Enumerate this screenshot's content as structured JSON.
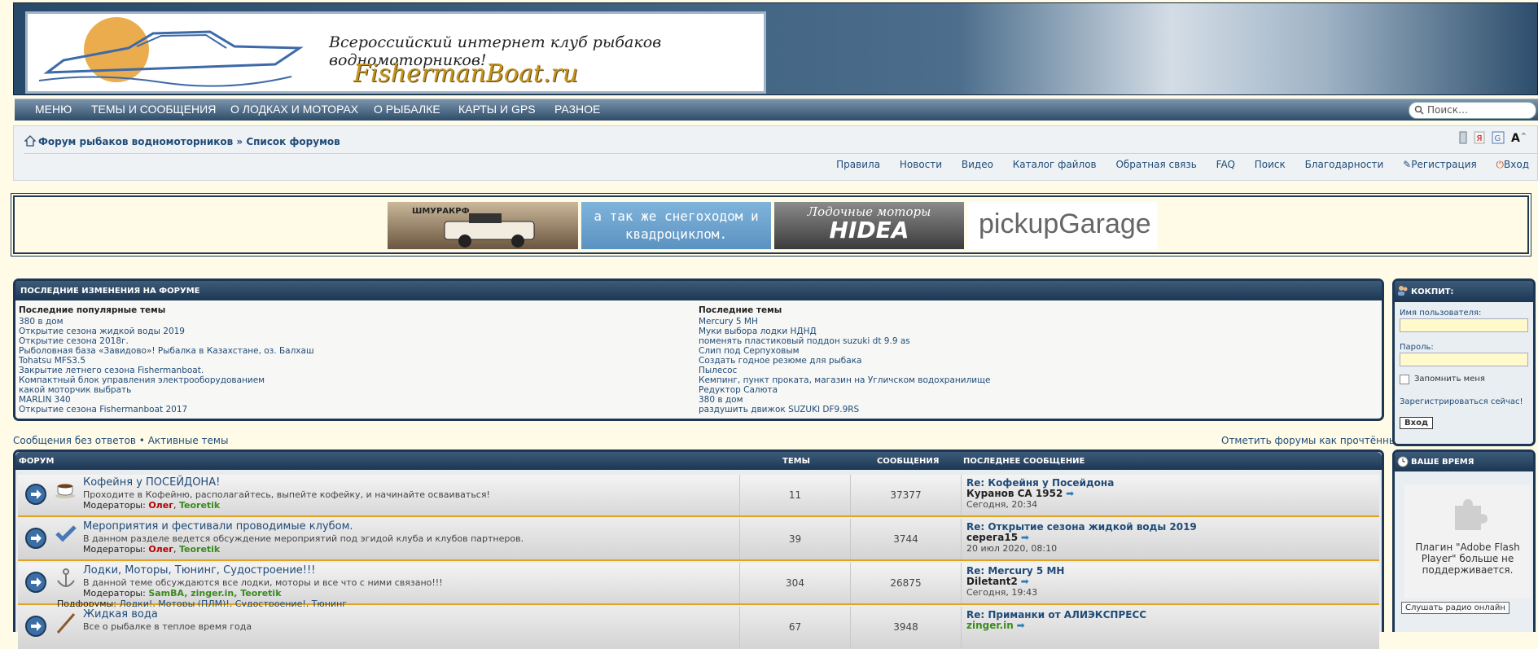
{
  "header": {
    "slogan": "Всероссийский интернет клуб рыбаков водномоторников!",
    "brand": "FishermanBoat.ru"
  },
  "nav": {
    "items": [
      "МЕНЮ",
      "ТЕМЫ И СООБЩЕНИЯ",
      "О ЛОДКАХ И МОТОРАХ",
      "О РЫБАЛКЕ",
      "КАРТЫ И GPS",
      "РАЗНОЕ"
    ],
    "search_placeholder": "Поиск…"
  },
  "breadcrumb": {
    "text": "Форум рыбаков водномоторников » Список форумов"
  },
  "toplinks": [
    "Правила",
    "Новости",
    "Видео",
    "Каталог файлов",
    "Обратная связь",
    "FAQ",
    "Поиск",
    "Благодарности",
    "Регистрация",
    "Вход"
  ],
  "banners": {
    "b1": "ШМУРАКРФ",
    "b2": "а так же снегоходом и квадроциклом.",
    "b3_title": "Лодочные моторы",
    "b3_brand": "HIDEA",
    "b4": "pickupGarage"
  },
  "recent": {
    "title": "ПОСЛЕДНИЕ ИЗМЕНЕНИЯ НА ФОРУМЕ",
    "popular_heading": "Последние популярные темы",
    "popular": [
      "380 в дом",
      "Открытие сезона жидкой воды 2019",
      "Открытие сезона 2018г.",
      "Рыболовная база «Завидово»! Рыбалка в Казахстане, оз. Балхаш",
      "Tohatsu MFS3.5",
      "Закрытие летнего сезона Fishermanboat.",
      "Компактный блок управления электрооборудованием",
      "какой моторчик выбрать",
      "MARLIN 340",
      "Открытие сезона Fishermanboat 2017"
    ],
    "last_heading": "Последние темы",
    "last": [
      "Mercury 5 MH",
      "Муки выбора лодки НДНД",
      "поменять пластиковый поддон suzuki dt 9.9 as",
      "Слип под Серпуховым",
      "Создать годное резюме для рыбака",
      "Пылесос",
      "Кемпинг, пункт проката, магазин на Угличском водохранилище",
      "Редуктор Салюта",
      "380 в дом",
      "раздушить движок SUZUKI DF9.9RS"
    ]
  },
  "links_left": "Сообщения без ответов • Активные темы",
  "links_right": "Отметить форумы как прочтённые",
  "forum": {
    "headers": {
      "forum": "ФОРУМ",
      "topics": "ТЕМЫ",
      "posts": "СООБЩЕНИЯ",
      "last": "ПОСЛЕДНЕЕ СООБЩЕНИЕ"
    },
    "rows": [
      {
        "title": "Кофейня у ПОСЕЙДОНА!",
        "desc": "Проходите в Кофейню, располагайтесь, выпейте кофейку, и начинайте осваиваться!",
        "mods_label": "Модераторы:",
        "mod1": "Олег",
        "mod2": "Teoretik",
        "topics": "11",
        "posts": "37377",
        "last_title": "Re: Кофейня у Посейдона",
        "last_user": "Куранов СА 1952",
        "last_date": "Сегодня, 20:34"
      },
      {
        "title": "Мероприятия и фестивали проводимые клубом.",
        "desc": "В данном разделе ведется обсуждение мероприятий под эгидой клуба и клубов партнеров.",
        "mods_label": "Модераторы:",
        "mod1": "Олег",
        "mod2": "Teoretik",
        "topics": "39",
        "posts": "3744",
        "last_title": "Re: Открытие сезона жидкой воды 2019",
        "last_user": "серега15",
        "last_date": "20 июл 2020, 08:10"
      },
      {
        "title": "Лодки, Моторы, Тюнинг, Судостроение!!!",
        "desc": "В данной теме обсуждаются все лодки, моторы и все что с ними связано!!!",
        "mods_label": "Модераторы:",
        "mods_list": "SamBA, zinger.in, Teoretik",
        "subs_label": "Подфорумы:",
        "subs": "Лодки!, Моторы (ПЛМ)!, Судостроение!, Тюнинг",
        "topics": "304",
        "posts": "26875",
        "last_title": "Re: Mercury 5 MH",
        "last_user": "Diletant2",
        "last_date": "Сегодня, 19:43"
      },
      {
        "title": "Жидкая вода",
        "desc": "Все о рыбалке в теплое время года",
        "topics": "67",
        "posts": "3948",
        "last_title": "Re: Приманки от АЛИЭКСПРЕСС",
        "last_user": "zinger.in"
      }
    ]
  },
  "cockpit": {
    "title": "КОКПИТ:",
    "user_label": "Имя пользователя:",
    "pass_label": "Пароль:",
    "remember": "Запомнить меня",
    "register": "Зарегистрироваться сейчас!",
    "login": "Вход"
  },
  "time": {
    "title": "ВАШЕ ВРЕМЯ",
    "flash": "Плагин \"Adobe Flash Player\" больше не поддерживается.",
    "radio": "Слушать радио онлайн"
  }
}
